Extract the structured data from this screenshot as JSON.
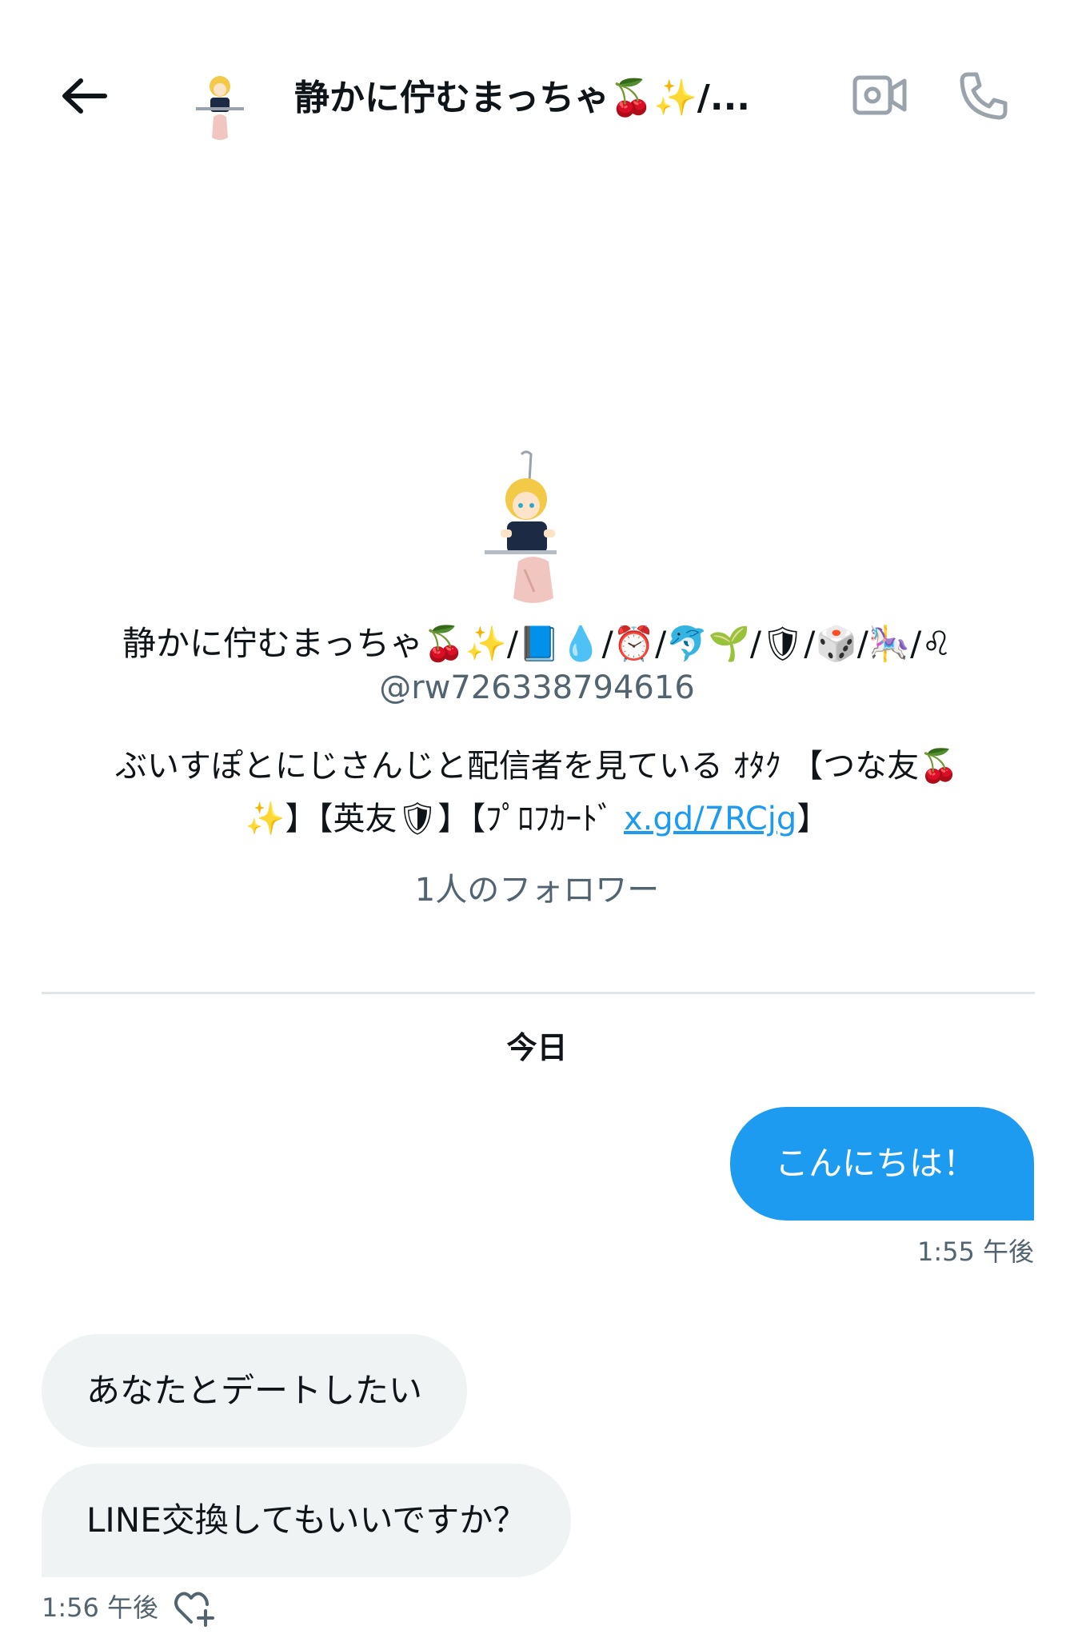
{
  "header": {
    "title": "静かに佇むまっちゃ🍒✨/...",
    "back_icon": "arrow-left-icon",
    "video_icon": "video-camera-icon",
    "phone_icon": "phone-icon"
  },
  "profile": {
    "display_name": "静かに佇むまっちゃ🍒✨/📘💧/⏰/🐬🌱/🛡/🎲/🎠/♌",
    "handle": "@rw726338794616",
    "bio_text": "ぶいすぽとにじさんじと配信者を見ている ｵﾀｸ 【つな友🍒✨】【英友🛡】【ﾌﾟﾛﾌｶｰﾄﾞ ",
    "bio_link": "x.gd/7RCjg",
    "bio_end": "】",
    "followers": "1人のフォロワー"
  },
  "chat": {
    "date_label": "今日",
    "messages": [
      {
        "direction": "sent",
        "text": "こんにちは！",
        "time": "1:55 午後"
      },
      {
        "direction": "received",
        "text": "あなたとデートしたい"
      },
      {
        "direction": "received",
        "text": "LINE交換してもいいですか？",
        "time": "1:56 午後"
      }
    ],
    "reaction_icon": "heart-plus-icon"
  },
  "colors": {
    "accent": "#1d9bf0",
    "received_bubble": "#eff3f4",
    "secondary_text": "#536471",
    "divider": "#dfe5e9"
  }
}
